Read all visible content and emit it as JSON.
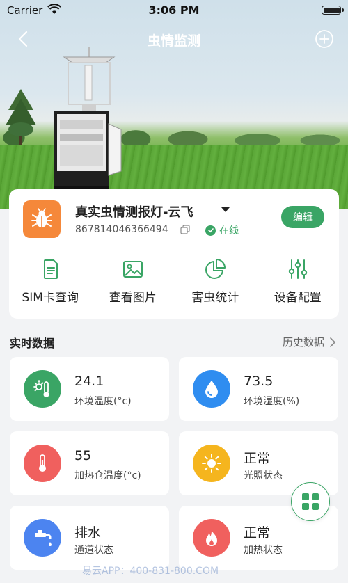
{
  "status_bar": {
    "carrier": "Carrier",
    "time": "3:06 PM"
  },
  "nav": {
    "title": "虫情监测",
    "back_icon": "chevron-left-icon",
    "add_icon": "plus-circle-icon"
  },
  "device": {
    "name": "真实虫情测报灯-云飞",
    "id": "867814046366494",
    "status": "在线",
    "edit_label": "编辑",
    "icon": "bug-icon"
  },
  "functions": [
    {
      "label": "SIM卡查询",
      "icon": "sim-card-icon"
    },
    {
      "label": "查看图片",
      "icon": "image-icon"
    },
    {
      "label": "害虫统计",
      "icon": "pie-chart-icon"
    },
    {
      "label": "设备配置",
      "icon": "sliders-icon"
    }
  ],
  "realtime": {
    "title": "实时数据",
    "history_label": "历史数据"
  },
  "tiles": [
    {
      "value": "24.1",
      "label": "环境温度(°c)",
      "icon": "sun-thermometer-icon",
      "color": "#3aa565"
    },
    {
      "value": "73.5",
      "label": "环境湿度(%)",
      "icon": "water-drop-icon",
      "color": "#2f8df0"
    },
    {
      "value": "55",
      "label": "加热仓温度(°c)",
      "icon": "thermometer-icon",
      "color": "#f0605e"
    },
    {
      "value": "正常",
      "label": "光照状态",
      "icon": "sun-icon",
      "color": "#f5b51e"
    },
    {
      "value": "排水",
      "label": "通道状态",
      "icon": "faucet-icon",
      "color": "#4c84f0"
    },
    {
      "value": "正常",
      "label": "加热状态",
      "icon": "flame-icon",
      "color": "#f0605e"
    }
  ],
  "fab": {
    "icon": "grid-icon"
  },
  "colors": {
    "accent": "#3aa565",
    "device_icon_bg": "#f5883a"
  },
  "watermark": "易云APP：400-831-800.COM"
}
